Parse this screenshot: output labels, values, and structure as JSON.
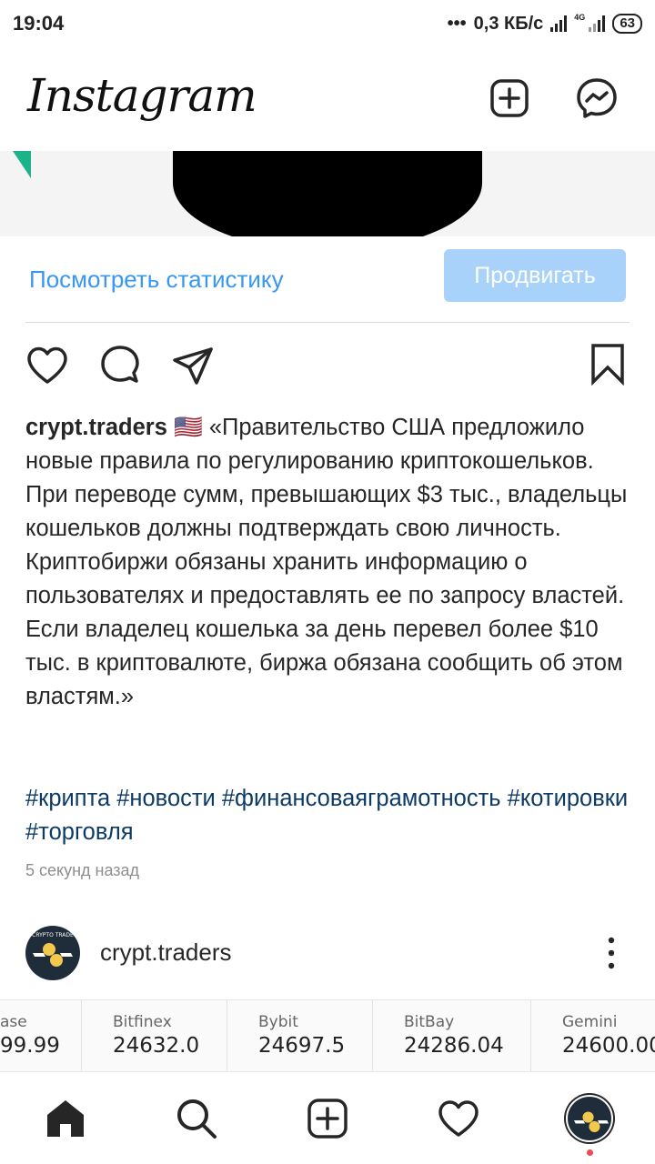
{
  "status_bar": {
    "time": "19:04",
    "network_speed": "0,3 КБ/с",
    "network_type": "4G",
    "battery": "63"
  },
  "header": {
    "logo": "Instagram",
    "icons": [
      "new-post-icon",
      "messenger-icon"
    ]
  },
  "insights": {
    "view_stats_label": "Посмотреть статистику",
    "promote_label": "Продвигать"
  },
  "actions": {
    "icons": [
      "heart-icon",
      "comment-icon",
      "share-icon",
      "bookmark-icon"
    ]
  },
  "caption": {
    "username": "crypt.traders",
    "flag": "🇺🇸",
    "text": "«Правительство США предложило новые правила по регулированию криптокошельков. При переводе сумм, превышающих $3 тыс., владельцы кошельков должны подтверждать свою личность. Криптобиржи обязаны хранить информацию о пользователях и предоставлять ее по запросу властей. Если владелец кошелька за день перевел более $10 тыс. в криптовалюте, биржа обязана сообщить об этом властям.»",
    "hashtags": "#крипта #новости #финансоваяграмотность #котировки #торговля",
    "time_ago": "5 секунд назад"
  },
  "next_post": {
    "username": "crypt.traders",
    "avatar_text": "CRYPTO TRADE"
  },
  "ticker": [
    {
      "name": "ase",
      "value": "99.99"
    },
    {
      "name": "Bitfinex",
      "value": "24632.0"
    },
    {
      "name": "Bybit",
      "value": "24697.5"
    },
    {
      "name": "BitBay",
      "value": "24286.04"
    },
    {
      "name": "Gemini",
      "value": "24600.00"
    }
  ],
  "bottom_nav": {
    "icons": [
      "home-icon",
      "search-icon",
      "add-icon",
      "activity-icon",
      "profile-avatar"
    ]
  },
  "colors": {
    "link_blue": "#3897f0",
    "promote_button": "#a8d2f9",
    "hashtag": "#0c3a67",
    "muted": "#8e8e8e"
  }
}
